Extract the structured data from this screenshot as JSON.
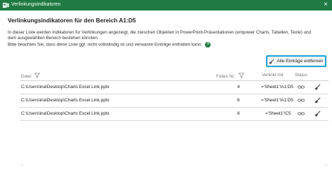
{
  "window": {
    "title": "Verlinkungsindikatoren",
    "close": "×"
  },
  "heading": "Verlinkungsindikatoren für den Bereich A1:D5",
  "description": {
    "line1": "In dieser Liste werden Indikatoren für Verlinkungen angezeigt, die zwischen Objekten in PowerPoint-Präsentationen (empower Charts, Tabellen, Texte) und",
    "line2": "dem ausgewählten Bereich bestehen könnten.",
    "line3": "Bitte beachten Sie, dass diese Liste ggf. nicht vollständig ist und verwaiste Einträge enthalten kann."
  },
  "remove_button": {
    "label": "Alle Einträge entfernen"
  },
  "columns": {
    "datei": "Datei",
    "folien": "Folien Nr.",
    "verlinkt": "Verlinkt mit",
    "status": "Status"
  },
  "rows": [
    {
      "datei": "C:\\Users\\ina\\Desktop\\Charts Excel Link.pptx",
      "folie": "4",
      "verlinkt": "='Sheet1'!A1:D5"
    },
    {
      "datei": "C:\\Users\\ina\\Desktop\\Charts Excel Link.pptx",
      "folie": "6",
      "verlinkt": "='Sheet1'!A1:D5"
    },
    {
      "datei": "C:\\Users\\ina\\Desktop\\Charts Excel Link.pptx",
      "folie": "8",
      "verlinkt": "='Sheet1'!C5"
    }
  ],
  "icons": {
    "app": "powerpoint-icon",
    "help": "help-icon",
    "filter": "filter-icon",
    "link": "link-icon",
    "broom": "broom-icon"
  },
  "colors": {
    "titlebar": "#1f7a43",
    "button_border": "#1aa3d6"
  }
}
